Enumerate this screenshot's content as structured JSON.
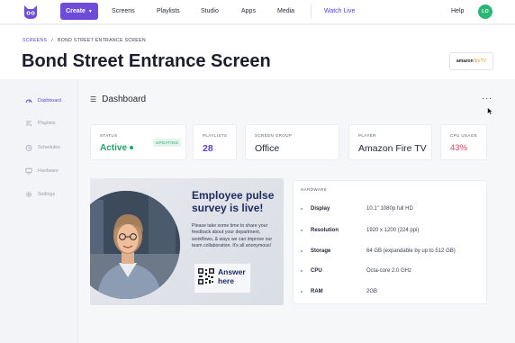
{
  "nav": {
    "create_label": "Create",
    "items": [
      "Screens",
      "Playlists",
      "Studio",
      "Apps",
      "Media"
    ],
    "watch_live": "Watch Live",
    "help": "Help",
    "avatar_initials": "LO"
  },
  "breadcrumb": {
    "parent": "SCREENS",
    "separator": "/",
    "current": "BOND STREET ENTRANCE SCREEN"
  },
  "page_title": "Bond Street Entrance Screen",
  "player_logo": {
    "brand": "amazon",
    "suffix": "fireTV"
  },
  "sidebar": {
    "items": [
      {
        "label": "Dashboard",
        "icon": "gauge-icon",
        "active": true
      },
      {
        "label": "Playlists",
        "icon": "playlist-icon",
        "active": false
      },
      {
        "label": "Schedules",
        "icon": "clock-icon",
        "active": false
      },
      {
        "label": "Hardware",
        "icon": "monitor-icon",
        "active": false
      },
      {
        "label": "Settings",
        "icon": "gear-icon",
        "active": false
      }
    ]
  },
  "dashboard": {
    "title": "Dashboard",
    "more": "···",
    "stats": {
      "status": {
        "label": "STATUS",
        "value": "Active",
        "badge": "UPDATING"
      },
      "playlists": {
        "label": "PLAYLISTS",
        "value": "28"
      },
      "screen_group": {
        "label": "SCREEN GROUP",
        "value": "Office"
      },
      "player": {
        "label": "PLAYER",
        "value": "Amazon Fire TV"
      },
      "cpu": {
        "label": "CPU USAGE",
        "value": "43%"
      }
    },
    "preview": {
      "title": "Employee pulse survey is live!",
      "body": "Please take some time to share your feedback about your department, workflows, & ways we can improve our team collaboration. It's all anonymous!",
      "cta_line1": "Answer",
      "cta_line2": "here"
    },
    "hardware": {
      "title": "HARDWARE",
      "rows": [
        {
          "key": "Display",
          "value": "10.1\" 1080p full HD"
        },
        {
          "key": "Resolution",
          "value": "1920 x 1200 (224 ppi)"
        },
        {
          "key": "Storage",
          "value": "64 GB (expandable by up to 512 GB)"
        },
        {
          "key": "CPU",
          "value": "Octa-core 2.0 GHz"
        },
        {
          "key": "RAM",
          "value": "2GB"
        }
      ]
    }
  },
  "colors": {
    "accent": "#6c4cd8",
    "active_green": "#21a36a",
    "cpu_red": "#e0455f",
    "avatar_green": "#2bb673"
  }
}
